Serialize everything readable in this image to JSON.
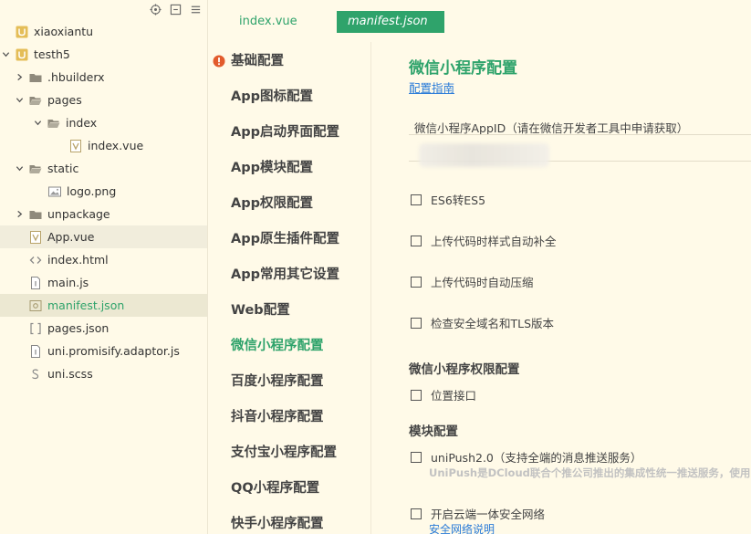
{
  "explorer": {
    "items": [
      {
        "label": "xiaoxiantu",
        "type": "project",
        "expanded": false
      },
      {
        "label": "testh5",
        "type": "project",
        "expanded": true
      },
      {
        "label": ".hbuilderx",
        "type": "folder",
        "expanded": false
      },
      {
        "label": "pages",
        "type": "folder",
        "expanded": true
      },
      {
        "label": "index",
        "type": "folder",
        "expanded": true
      },
      {
        "label": "index.vue",
        "type": "vue"
      },
      {
        "label": "static",
        "type": "folder",
        "expanded": true
      },
      {
        "label": "logo.png",
        "type": "image"
      },
      {
        "label": "unpackage",
        "type": "folder",
        "expanded": false
      },
      {
        "label": "App.vue",
        "type": "vue"
      },
      {
        "label": "index.html",
        "type": "html"
      },
      {
        "label": "main.js",
        "type": "js"
      },
      {
        "label": "manifest.json",
        "type": "json"
      },
      {
        "label": "pages.json",
        "type": "json-bracket"
      },
      {
        "label": "uni.promisify.adaptor.js",
        "type": "js"
      },
      {
        "label": "uni.scss",
        "type": "scss"
      }
    ]
  },
  "tabs": [
    {
      "label": "index.vue",
      "active": false
    },
    {
      "label": "manifest.json",
      "active": true
    }
  ],
  "nav": {
    "items": [
      "基础配置",
      "App图标配置",
      "App启动界面配置",
      "App模块配置",
      "App权限配置",
      "App原生插件配置",
      "App常用其它设置",
      "Web配置",
      "微信小程序配置",
      "百度小程序配置",
      "抖音小程序配置",
      "支付宝小程序配置",
      "QQ小程序配置",
      "快手小程序配置"
    ],
    "active_index": 8
  },
  "content": {
    "title": "微信小程序配置",
    "guide_link": "配置指南",
    "appid_label": "微信小程序AppID（请在微信开发者工具中申请获取）",
    "appid_value": "",
    "options": [
      {
        "label": "ES6转ES5",
        "checked": false
      },
      {
        "label": "上传代码时样式自动补全",
        "checked": false
      },
      {
        "label": "上传代码时自动压缩",
        "checked": false
      },
      {
        "label": "检查安全域名和TLS版本",
        "checked": false
      }
    ],
    "permission_title": "微信小程序权限配置",
    "permission_options": [
      {
        "label": "位置接口",
        "checked": false
      }
    ],
    "module_title": "模块配置",
    "modules": [
      {
        "label": "uniPush2.0（支持全端的消息推送服务）",
        "checked": false,
        "desc": "UniPush是DCloud联合个推公司推出的集成性统一推送服务，使用"
      },
      {
        "label": "开启云端一体安全网络",
        "checked": false,
        "link": "安全网络说明"
      }
    ]
  },
  "colors": {
    "accent": "#2fa36b",
    "link": "#2a7bd8",
    "warning": "#e25b2c",
    "background": "#fffae8"
  }
}
